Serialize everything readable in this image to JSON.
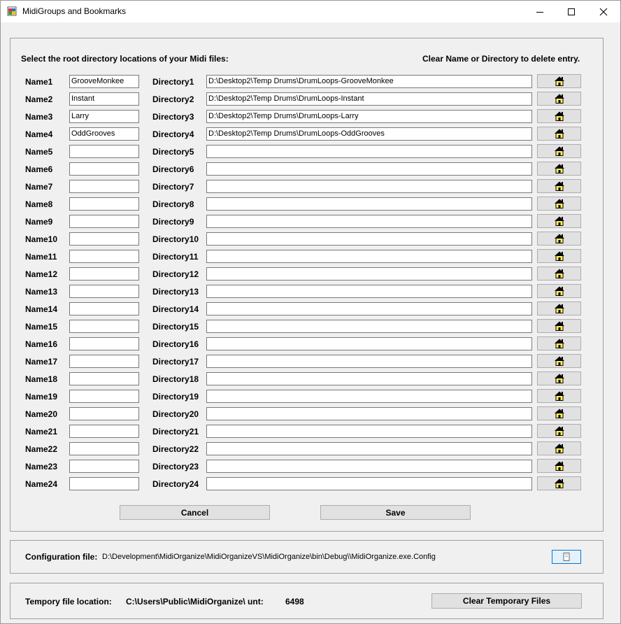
{
  "window": {
    "title": "MidiGroups and Bookmarks"
  },
  "main": {
    "instruction": "Select the root directory locations of your Midi files:",
    "hint": "Clear Name or Directory to delete entry.",
    "entries": [
      {
        "name_label": "Name1",
        "name_value": "GrooveMonkee",
        "dir_label": "Directory1",
        "dir_value": "D:\\Desktop2\\Temp Drums\\DrumLoops-GrooveMonkee"
      },
      {
        "name_label": "Name2",
        "name_value": "Instant",
        "dir_label": "Directory2",
        "dir_value": "D:\\Desktop2\\Temp Drums\\DrumLoops-Instant"
      },
      {
        "name_label": "Name3",
        "name_value": "Larry",
        "dir_label": "Directory3",
        "dir_value": "D:\\Desktop2\\Temp Drums\\DrumLoops-Larry"
      },
      {
        "name_label": "Name4",
        "name_value": "OddGrooves",
        "dir_label": "Directory4",
        "dir_value": "D:\\Desktop2\\Temp Drums\\DrumLoops-OddGrooves"
      },
      {
        "name_label": "Name5",
        "name_value": "",
        "dir_label": "Directory5",
        "dir_value": ""
      },
      {
        "name_label": "Name6",
        "name_value": "",
        "dir_label": "Directory6",
        "dir_value": ""
      },
      {
        "name_label": "Name7",
        "name_value": "",
        "dir_label": "Directory7",
        "dir_value": ""
      },
      {
        "name_label": "Name8",
        "name_value": "",
        "dir_label": "Directory8",
        "dir_value": ""
      },
      {
        "name_label": "Name9",
        "name_value": "",
        "dir_label": "Directory9",
        "dir_value": ""
      },
      {
        "name_label": "Name10",
        "name_value": "",
        "dir_label": "Directory10",
        "dir_value": ""
      },
      {
        "name_label": "Name11",
        "name_value": "",
        "dir_label": "Directory11",
        "dir_value": ""
      },
      {
        "name_label": "Name12",
        "name_value": "",
        "dir_label": "Directory12",
        "dir_value": ""
      },
      {
        "name_label": "Name13",
        "name_value": "",
        "dir_label": "Directory13",
        "dir_value": ""
      },
      {
        "name_label": "Name14",
        "name_value": "",
        "dir_label": "Directory14",
        "dir_value": ""
      },
      {
        "name_label": "Name15",
        "name_value": "",
        "dir_label": "Directory15",
        "dir_value": ""
      },
      {
        "name_label": "Name16",
        "name_value": "",
        "dir_label": "Directory16",
        "dir_value": ""
      },
      {
        "name_label": "Name17",
        "name_value": "",
        "dir_label": "Directory17",
        "dir_value": ""
      },
      {
        "name_label": "Name18",
        "name_value": "",
        "dir_label": "Directory18",
        "dir_value": ""
      },
      {
        "name_label": "Name19",
        "name_value": "",
        "dir_label": "Directory19",
        "dir_value": ""
      },
      {
        "name_label": "Name20",
        "name_value": "",
        "dir_label": "Directory20",
        "dir_value": ""
      },
      {
        "name_label": "Name21",
        "name_value": "",
        "dir_label": "Directory21",
        "dir_value": ""
      },
      {
        "name_label": "Name22",
        "name_value": "",
        "dir_label": "Directory22",
        "dir_value": ""
      },
      {
        "name_label": "Name23",
        "name_value": "",
        "dir_label": "Directory23",
        "dir_value": ""
      },
      {
        "name_label": "Name24",
        "name_value": "",
        "dir_label": "Directory24",
        "dir_value": ""
      }
    ],
    "browse_icon": "folder-home-icon",
    "cancel_label": "Cancel",
    "save_label": "Save"
  },
  "config": {
    "label": "Configuration file:",
    "path": "D:\\Development\\MidiOrganize\\MidiOrganizeVS\\MidiOrganize\\bin\\Debug\\\\MidiOrganize.exe.Config",
    "open_icon": "document-icon"
  },
  "temp": {
    "label": "Tempory file location:",
    "path": "C:\\Users\\Public\\MidiOrganize\\ unt:",
    "count": "6498",
    "clear_label": "Clear Temporary Files"
  },
  "colors": {
    "window_bg": "#f0f0f0",
    "titlebar_bg": "#ffffff",
    "button_bg": "#e1e1e1",
    "icon_yellow": "#ffef5a"
  }
}
